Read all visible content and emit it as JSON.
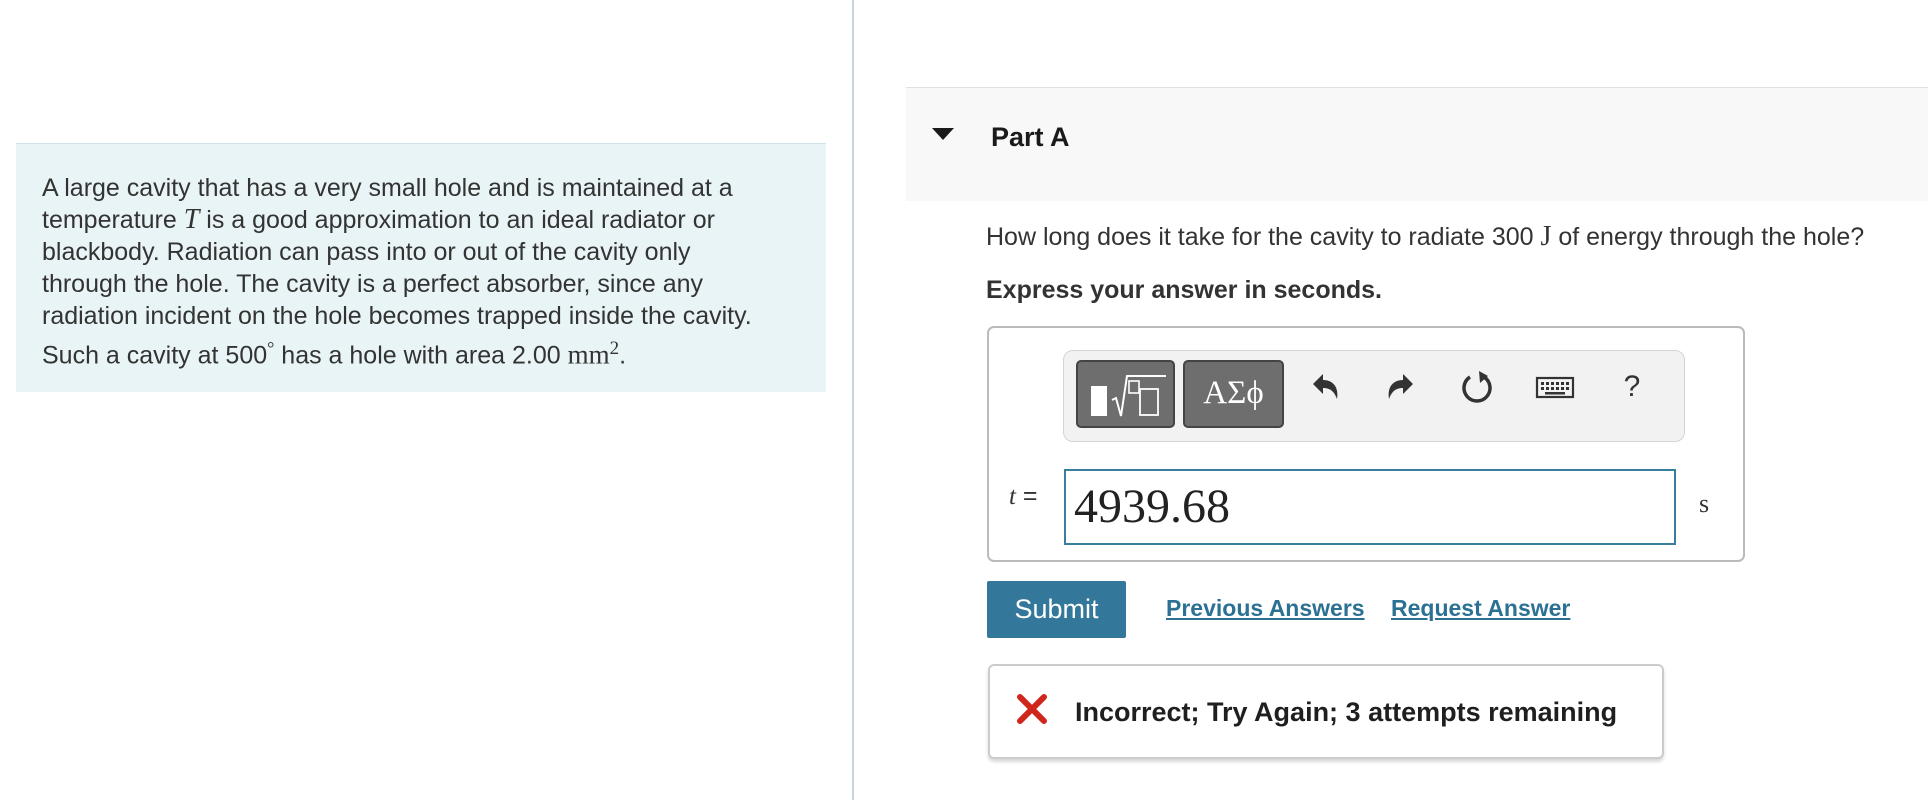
{
  "problem": {
    "text_1": "A large cavity that has a very small hole and is maintained at a",
    "text_2a": "temperature ",
    "var_T": "T",
    "text_2b": " is a good approximation to an ideal radiator or",
    "text_3": "blackbody. Radiation can pass into or out of the cavity only",
    "text_4": "through the hole. The cavity is a perfect absorber, since any",
    "text_5": "radiation incident on the hole becomes trapped inside the cavity.",
    "text_6a": "Such a cavity at 500",
    "degree": "°",
    "text_6b": " has a hole with area 2.00 ",
    "unit_mm": "mm",
    "exp_2": "2",
    "period": "."
  },
  "part": {
    "title": "Part A"
  },
  "question": {
    "text_a": "How long does it take for the cavity to radiate 300 ",
    "unit_J": "J",
    "text_b": " of energy through the hole?",
    "instruction": "Express your answer in seconds."
  },
  "toolbar": {
    "greek_label": "ΑΣϕ",
    "help_label": "?",
    "icons": [
      "templates-icon",
      "greek-symbols-icon",
      "undo-icon",
      "redo-icon",
      "reset-icon",
      "keyboard-icon",
      "help-icon"
    ]
  },
  "answer": {
    "variable": "t",
    "equals": " = ",
    "value": "4939.68",
    "unit": "s"
  },
  "actions": {
    "submit_label": "Submit",
    "previous_answers_label": "Previous Answers",
    "request_answer_label": "Request Answer"
  },
  "feedback": {
    "message": "Incorrect; Try Again; 3 attempts remaining",
    "status_color": "#d0271d"
  },
  "colors": {
    "accent": "#33789a",
    "link": "#2c7194",
    "problem_bg": "#e8f4f6"
  }
}
